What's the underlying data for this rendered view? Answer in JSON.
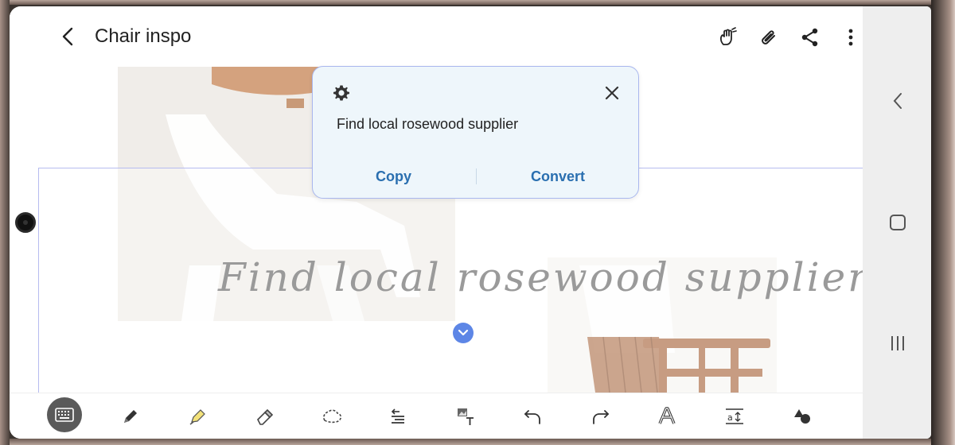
{
  "app": {
    "title": "Chair inspo",
    "top_icons": [
      "draw-hand-icon",
      "attach-icon",
      "share-icon",
      "more-icon"
    ]
  },
  "canvas": {
    "handwriting": "Find local rosewood supplier"
  },
  "popup": {
    "recognized_text": "Find local rosewood supplier",
    "copy_label": "Copy",
    "convert_label": "Convert"
  },
  "toolbar": {
    "tools": [
      "keyboard-icon",
      "pen-icon",
      "highlighter-icon",
      "eraser-icon",
      "lasso-icon",
      "align-icon",
      "text-image-icon",
      "undo-icon",
      "redo-icon",
      "handwriting-style-icon",
      "text-size-icon",
      "shapes-icon"
    ]
  },
  "navbar": {
    "buttons": [
      "back-icon",
      "home-icon",
      "recents-icon"
    ]
  },
  "colors": {
    "accent": "#2a6fb0",
    "selection_border": "#b6bcf0",
    "popup_bg": "#eef6fb",
    "expand_button": "#5d86e6"
  }
}
